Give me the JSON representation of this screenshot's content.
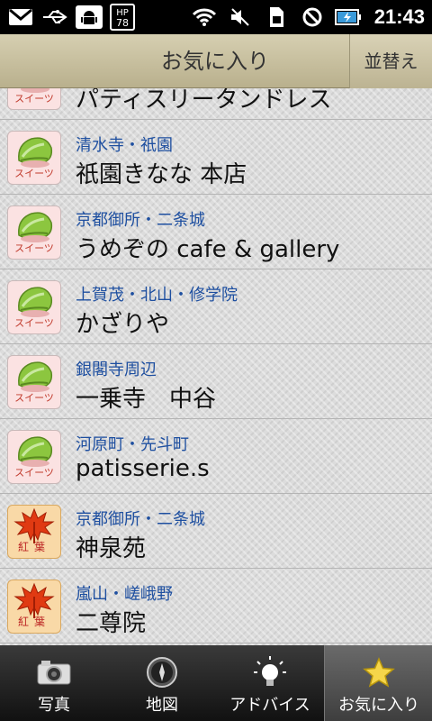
{
  "status_bar": {
    "time": "21:43",
    "icons": [
      "gmail-icon",
      "usb-icon",
      "android-debug-icon",
      "hp-badge-icon",
      "wifi-icon",
      "vibrate-mute-icon",
      "sim-icon",
      "no-signal-icon",
      "battery-charging-icon"
    ],
    "hp_badge": "HP\n78"
  },
  "title_bar": {
    "title": "お気に入り",
    "sort_label": "並替え"
  },
  "list": {
    "items": [
      {
        "category": "sweets",
        "category_label": "スイーツ",
        "area": "",
        "name": "パティスリータンドレス"
      },
      {
        "category": "sweets",
        "category_label": "スイーツ",
        "area": "清水寺・祇園",
        "name": "祇園きなな 本店"
      },
      {
        "category": "sweets",
        "category_label": "スイーツ",
        "area": "京都御所・二条城",
        "name": "うめぞの cafe & gallery"
      },
      {
        "category": "sweets",
        "category_label": "スイーツ",
        "area": "上賀茂・北山・修学院",
        "name": "かざりや"
      },
      {
        "category": "sweets",
        "category_label": "スイーツ",
        "area": "銀閣寺周辺",
        "name": "一乗寺　中谷"
      },
      {
        "category": "sweets",
        "category_label": "スイーツ",
        "area": "河原町・先斗町",
        "name": "patisserie.s"
      },
      {
        "category": "koyo",
        "category_label": "紅葉",
        "area": "京都御所・二条城",
        "name": "神泉苑"
      },
      {
        "category": "koyo",
        "category_label": "紅葉",
        "area": "嵐山・嵯峨野",
        "name": "二尊院"
      }
    ]
  },
  "tab_bar": {
    "tabs": [
      {
        "label": "写真",
        "icon": "camera-icon",
        "selected": false
      },
      {
        "label": "地図",
        "icon": "compass-icon",
        "selected": false
      },
      {
        "label": "アドバイス",
        "icon": "lightbulb-icon",
        "selected": false
      },
      {
        "label": "お気に入り",
        "icon": "star-icon",
        "selected": true
      }
    ]
  }
}
